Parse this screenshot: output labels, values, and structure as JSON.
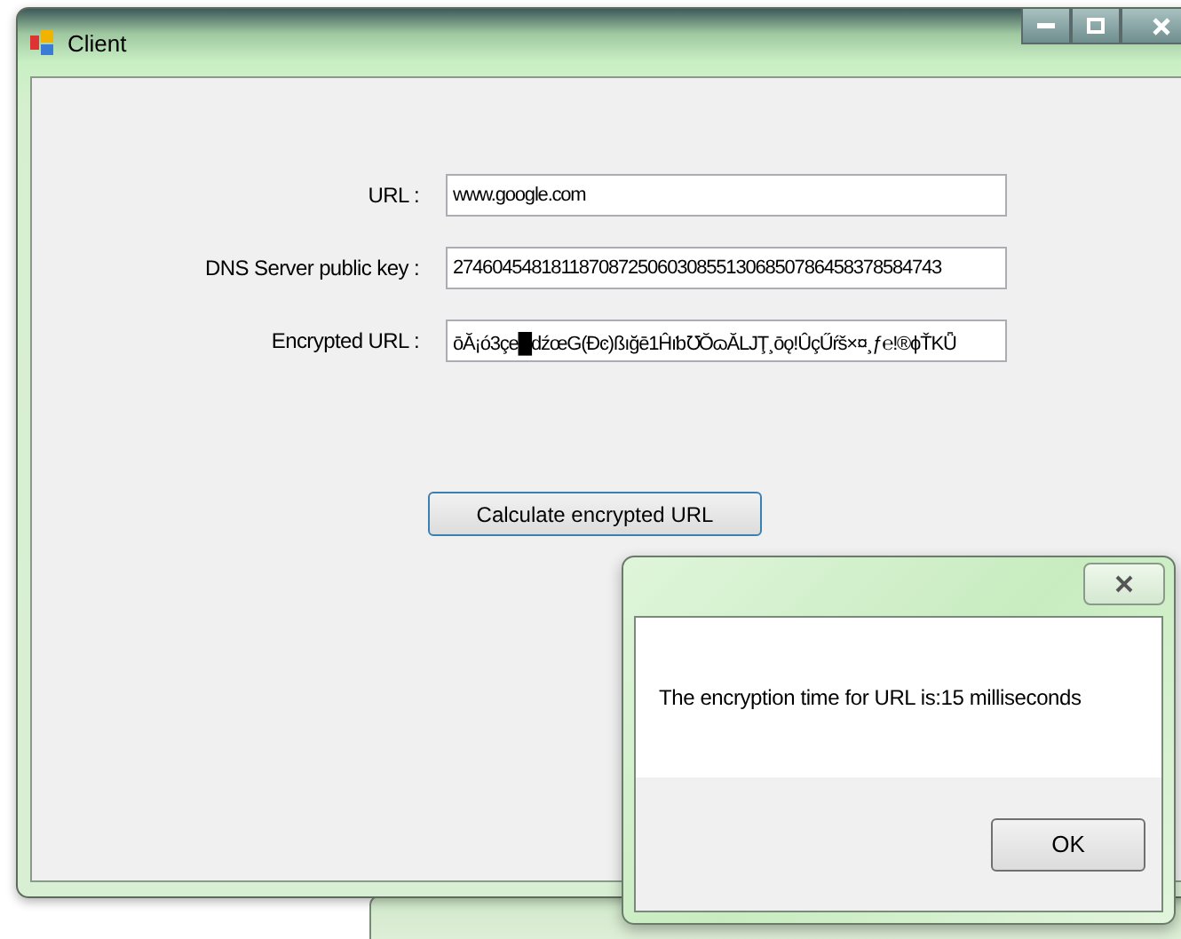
{
  "window": {
    "title": "Client"
  },
  "fields": [
    {
      "label": "URL :",
      "value": "www.google.com"
    },
    {
      "label": "DNS Server public key :",
      "value": "27460454818118708725060308551306850786458378584743"
    },
    {
      "label": "Encrypted URL :",
      "value": "ōĂ¡ó3çe█dźœG(Ðͼ)ßığē1Ĥıƅ℧ŎɷĂLJŢ¸ōǫ!ÛçŰŕš×¤¸ƒ℮!®ϕŤKǕ"
    }
  ],
  "calculate_button": "Calculate encrypted URL",
  "message_box": {
    "message": "The encryption time for URL is:15 milliseconds",
    "ok_button": "OK"
  }
}
